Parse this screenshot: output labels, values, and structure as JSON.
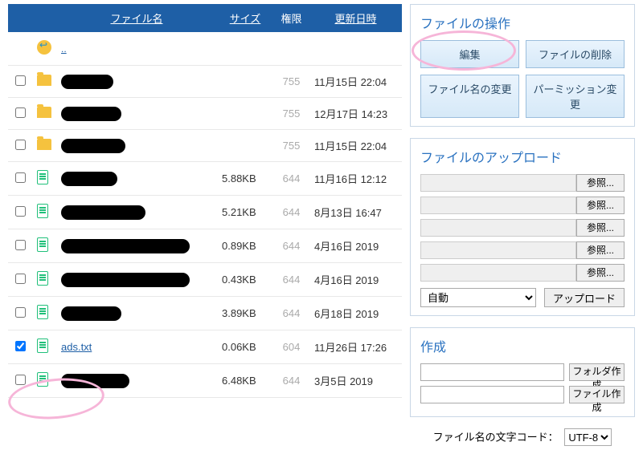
{
  "table": {
    "headers": {
      "filename": "ファイル名",
      "size": "サイズ",
      "perm": "権限",
      "date": "更新日時"
    },
    "up_link": "..",
    "rows": [
      {
        "type": "folder",
        "blacked_w": 65,
        "size": "",
        "perm": "755",
        "date": "11月15日 22:04",
        "checked": false
      },
      {
        "type": "folder",
        "blacked_w": 75,
        "size": "",
        "perm": "755",
        "date": "12月17日 14:23",
        "checked": false
      },
      {
        "type": "folder",
        "blacked_w": 80,
        "size": "",
        "perm": "755",
        "date": "11月15日 22:04",
        "checked": false
      },
      {
        "type": "file",
        "blacked_w": 70,
        "size": "5.88KB",
        "perm": "644",
        "date": "11月16日 12:12",
        "checked": false
      },
      {
        "type": "file",
        "blacked_w": 105,
        "size": "5.21KB",
        "perm": "644",
        "date": "8月13日 16:47",
        "checked": false
      },
      {
        "type": "file",
        "blacked_w": 160,
        "size": "0.89KB",
        "perm": "644",
        "date": "4月16日 2019",
        "checked": false
      },
      {
        "type": "file",
        "blacked_w": 160,
        "size": "0.43KB",
        "perm": "644",
        "date": "4月16日 2019",
        "checked": false
      },
      {
        "type": "file",
        "blacked_w": 75,
        "size": "3.89KB",
        "perm": "644",
        "date": "6月18日 2019",
        "checked": false
      },
      {
        "type": "file",
        "name": "ads.txt",
        "size": "0.06KB",
        "perm": "604",
        "date": "11月26日 17:26",
        "checked": true,
        "highlighted": true
      },
      {
        "type": "file",
        "blacked_w": 85,
        "size": "6.48KB",
        "perm": "644",
        "date": "3月5日 2019",
        "checked": false
      }
    ]
  },
  "ops": {
    "title": "ファイルの操作",
    "edit": "編集",
    "delete": "ファイルの削除",
    "rename": "ファイル名の変更",
    "chmod": "パーミッション変更"
  },
  "upload": {
    "title": "ファイルのアップロード",
    "browse": "参照...",
    "auto": "自動",
    "submit": "アップロード"
  },
  "create": {
    "title": "作成",
    "folder": "フォルダ作成",
    "file": "ファイル作成"
  },
  "charset": {
    "label": "ファイル名の文字コード：",
    "value": "UTF-8"
  }
}
